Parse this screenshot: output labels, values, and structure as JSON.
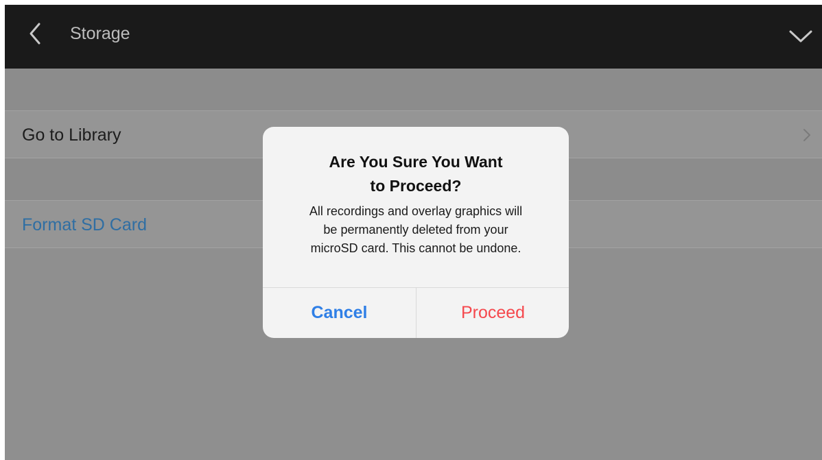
{
  "header": {
    "title": "Storage",
    "back_icon": "chevron-left-icon",
    "collapse_icon": "chevron-down-icon",
    "background_color": "#1a1a1a"
  },
  "rows": [
    {
      "label": "Go to Library",
      "icon": "chevron-right-icon"
    },
    {
      "label": "Format SD Card",
      "color": "#2f6ea3"
    }
  ],
  "dialog": {
    "title_line1": "Are You Sure You Want",
    "title_line2": "to Proceed?",
    "message_line1": "All recordings and overlay graphics will",
    "message_line2": "be permanently deleted from your",
    "message_line3": "microSD card. This cannot be undone.",
    "cancel_label": "Cancel",
    "proceed_label": "Proceed",
    "cancel_color": "#2f7fe6",
    "proceed_color": "#f5484d"
  }
}
